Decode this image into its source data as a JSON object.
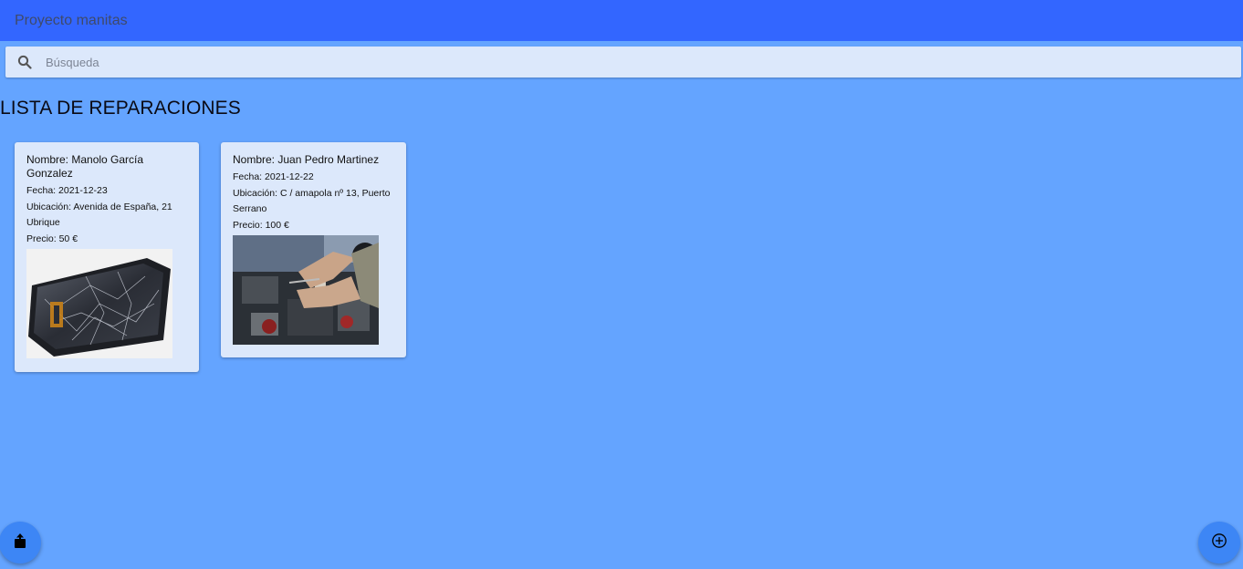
{
  "app": {
    "title": "Proyecto manitas"
  },
  "search": {
    "placeholder": "Búsqueda",
    "icon": "search-icon"
  },
  "list": {
    "title": "LISTA DE REPARACIONES",
    "items": [
      {
        "nombre": "Nombre: Manolo García Gonzalez",
        "fecha": "Fecha: 2021-12-23",
        "ubicacion": "Ubicación: Avenida de España, 21 Ubrique",
        "precio": "Precio: 50 €",
        "image": "broken-phone-photo"
      },
      {
        "nombre": "Nombre: Juan Pedro Martinez",
        "fecha": "Fecha: 2021-12-22",
        "ubicacion": "Ubicación: C / amapola nº 13, Puerto Serrano",
        "precio": "Precio: 100 €",
        "image": "car-engine-repair-photo"
      }
    ]
  },
  "fabs": {
    "share_icon": "share-icon",
    "add_icon": "add-circle-icon"
  },
  "colors": {
    "toolbar": "#3366ff",
    "background": "#64a4ff",
    "card": "#dce8fb",
    "fab": "#3d86f5"
  }
}
